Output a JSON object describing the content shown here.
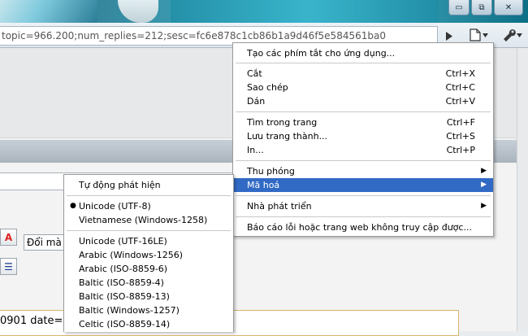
{
  "window": {
    "buttons": {
      "minimize": "▭",
      "maximize": "⧉",
      "close": "✕"
    }
  },
  "address_bar": {
    "url": "topic=966.200;num_replies=212;sesc=fc6e878c1cb86b1a9d46f5e584561ba0",
    "go_icon": "play-triangle-icon",
    "page_icon": "page-icon",
    "wrench_icon": "wrench-icon"
  },
  "page": {
    "format_select": "Đổi mà",
    "post_text": "0901 date="
  },
  "main_menu": {
    "items": [
      {
        "label": "Tạo các phím tắt cho ứng dụng..."
      },
      {
        "label": "Cắt",
        "shortcut": "Ctrl+X"
      },
      {
        "label": "Sao chép",
        "shortcut": "Ctrl+C"
      },
      {
        "label": "Dán",
        "shortcut": "Ctrl+V"
      },
      {
        "label": "Tìm trong trang",
        "shortcut": "Ctrl+F"
      },
      {
        "label": "Lưu trang thành...",
        "shortcut": "Ctrl+S"
      },
      {
        "label": "In...",
        "shortcut": "Ctrl+P"
      },
      {
        "label": "Thu phóng",
        "submenu": "▶"
      },
      {
        "label": "Mã hoá",
        "submenu": "▶"
      },
      {
        "label": "Nhà phát triển",
        "submenu": "▶"
      },
      {
        "label": "Báo cáo lỗi hoặc trang web không truy cập được..."
      }
    ]
  },
  "encoding_menu": {
    "items": [
      {
        "label": "Tự động phát hiện"
      },
      {
        "label": "Unicode (UTF-8)",
        "bullet": "●"
      },
      {
        "label": "Vietnamese (Windows-1258)"
      },
      {
        "label": "Unicode (UTF-16LE)"
      },
      {
        "label": "Arabic (Windows-1256)"
      },
      {
        "label": "Arabic (ISO-8859-6)"
      },
      {
        "label": "Baltic (ISO-8859-4)"
      },
      {
        "label": "Baltic (ISO-8859-13)"
      },
      {
        "label": "Baltic (Windows-1257)"
      },
      {
        "label": "Celtic (ISO-8859-14)"
      }
    ]
  },
  "colors": {
    "highlight": "#316ac5",
    "titlebar": "#3a9bb1"
  }
}
